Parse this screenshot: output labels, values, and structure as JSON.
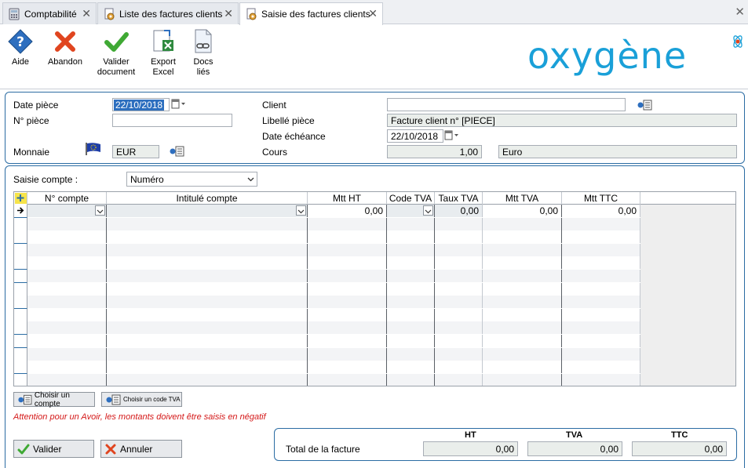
{
  "tabs": [
    {
      "label": "Comptabilité",
      "icon": "calculator-icon"
    },
    {
      "label": "Liste des factures clients",
      "icon": "gear-document-icon"
    },
    {
      "label": "Saisie des factures clients",
      "icon": "gear-document-icon",
      "active": true
    }
  ],
  "tabbar": {
    "close": "✕"
  },
  "toolbar": {
    "aide": "Aide",
    "abandon": "Abandon",
    "valider_l1": "Valider",
    "valider_l2": "document",
    "export_l1": "Export",
    "export_l2": "Excel",
    "docs_l1": "Docs",
    "docs_l2": "liés",
    "logo": "oxygène"
  },
  "header": {
    "date_piece_label": "Date pièce",
    "date_piece_value": "22/10/2018",
    "num_piece_label": "N° pièce",
    "num_piece_value": "",
    "monnaie_label": "Monnaie",
    "monnaie_value": "EUR",
    "client_label": "Client",
    "client_value": "",
    "libelle_label": "Libellé pièce",
    "libelle_value": "Facture client n° [PIECE]",
    "echeance_label": "Date échéance",
    "echeance_value": "22/10/2018",
    "cours_label": "Cours",
    "cours_value": "1,00",
    "cours_devise": "Euro"
  },
  "saisie": {
    "label": "Saisie compte :",
    "value": "Numéro"
  },
  "grid": {
    "columns": [
      "N° compte",
      "Intitulé compte",
      "Mtt HT",
      "Code TVA",
      "Taux TVA",
      "Mtt TVA",
      "Mtt TTC"
    ],
    "first_row": {
      "mtt_ht": "0,00",
      "taux_tva": "0,00",
      "mtt_tva": "0,00",
      "mtt_ttc": "0,00"
    },
    "row_count": 14
  },
  "buttons": {
    "choisir_compte": "Choisir un compte",
    "choisir_tva": "Choisir un code TVA",
    "valider": "Valider",
    "annuler": "Annuler"
  },
  "warning": "Attention  pour un Avoir, les montants doivent être saisis en négatif",
  "totals": {
    "label": "Total de la facture",
    "ht_label": "HT",
    "tva_label": "TVA",
    "ttc_label": "TTC",
    "ht": "0,00",
    "tva": "0,00",
    "ttc": "0,00"
  },
  "colors": {
    "accent": "#1aa0d8",
    "panel_border": "#2b6ca3",
    "warning": "#d41818"
  }
}
